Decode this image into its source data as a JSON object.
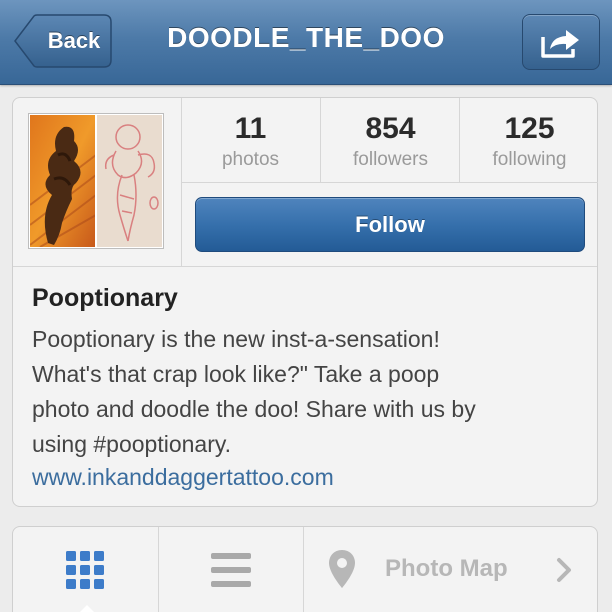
{
  "nav": {
    "back_label": "Back",
    "title": "DOODLE_THE_DOO",
    "share_icon": "share-arrow-icon"
  },
  "profile": {
    "stats": [
      {
        "value": "11",
        "label": "photos"
      },
      {
        "value": "854",
        "label": "followers"
      },
      {
        "value": "125",
        "label": "following"
      }
    ],
    "follow_label": "Follow",
    "name": "Pooptionary",
    "bio": "Pooptionary is the new inst-a-sensation!\nWhat's that crap look like?\" Take a poop\nphoto and doodle the doo! Share with us by\nusing #pooptionary.",
    "website": "www.inkanddaggertattoo.com"
  },
  "tabs": {
    "grid_icon": "grid-view-icon",
    "list_icon": "list-view-icon",
    "map_icon": "location-pin-icon",
    "photo_map_label": "Photo Map",
    "chevron_icon": "chevron-right-icon",
    "active_tab": "grid"
  },
  "colors": {
    "nav_bar": "#4d7aa8",
    "follow_button": "#3670ac",
    "active_grid": "#3d7cc9",
    "link": "#3b6d9e"
  }
}
